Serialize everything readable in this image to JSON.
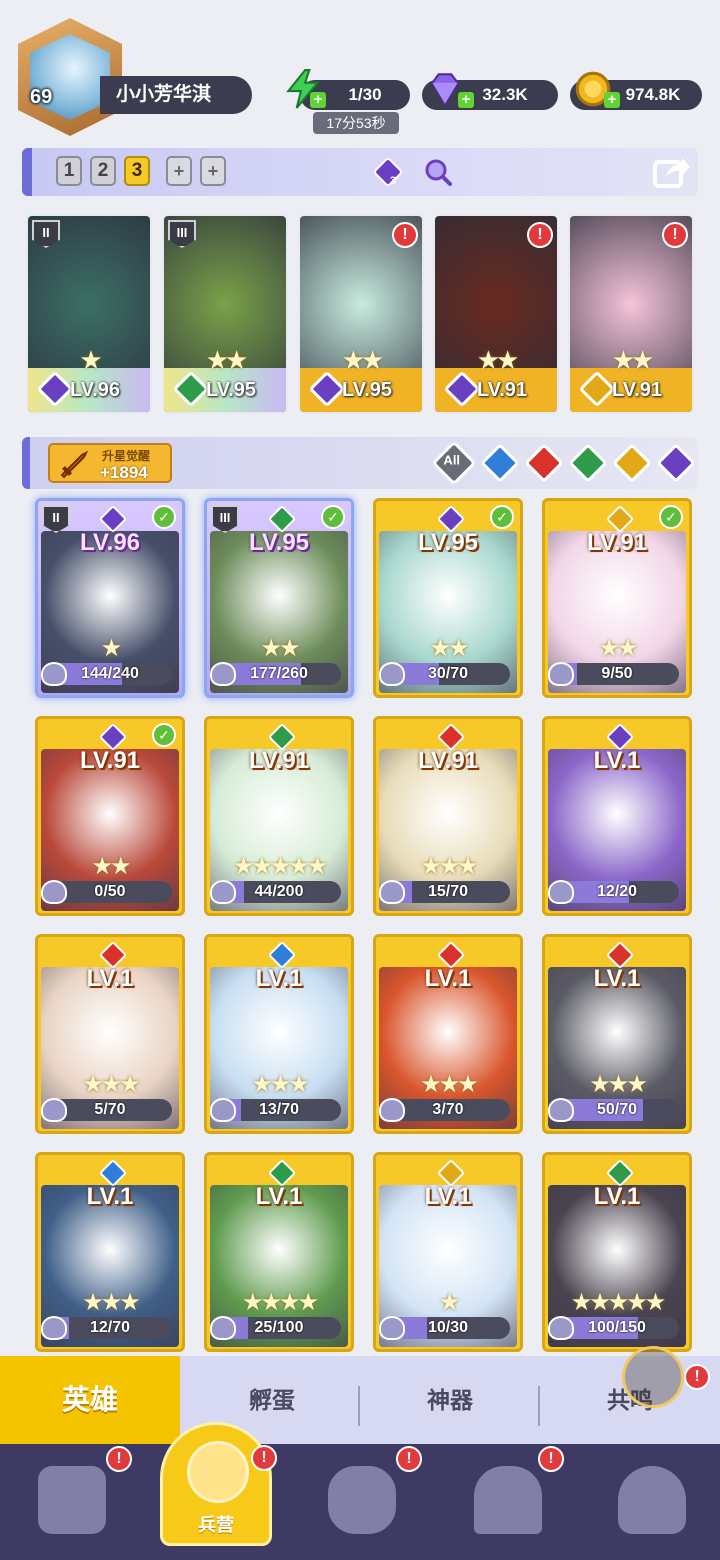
{
  "player": {
    "level": "69",
    "name": "小小芳华淇"
  },
  "resources": {
    "energy": {
      "value": "1/30",
      "timer": "17分53秒",
      "icon": "energy-bolt-icon",
      "color": "#3fcf55"
    },
    "gems": {
      "value": "32.3K",
      "icon": "purple-gem-icon",
      "color": "#8a63e8"
    },
    "gold": {
      "value": "974.8K",
      "icon": "gold-coin-icon",
      "color": "#f0b820"
    }
  },
  "team_bar": {
    "slots": [
      "1",
      "2",
      "3",
      "+",
      "+"
    ],
    "active_slot": "3",
    "dark_counter": "3"
  },
  "team": [
    {
      "level": "LV.96",
      "element": "dark",
      "rank": "II",
      "stars": "★",
      "alert": false
    },
    {
      "level": "LV.95",
      "element": "nature",
      "rank": "III",
      "stars": "★★",
      "alert": false
    },
    {
      "level": "LV.95",
      "element": "dark",
      "rank": "",
      "stars": "★★",
      "alert": true
    },
    {
      "level": "LV.91",
      "element": "dark",
      "rank": "",
      "stars": "★★",
      "alert": true
    },
    {
      "level": "LV.91",
      "element": "light",
      "rank": "",
      "stars": "★★",
      "alert": true
    }
  ],
  "filter_bar": {
    "star_up_label": "升星觉醒",
    "star_up_value": "+1894",
    "filter_all": "All",
    "elements": [
      "water",
      "fire",
      "nature",
      "light",
      "dark"
    ]
  },
  "element_colors": {
    "dark": "#6a3fc2",
    "nature": "#2e9b4a",
    "fire": "#d8322a",
    "water": "#2f7fd8",
    "light": "#e2a818"
  },
  "heroes": [
    {
      "level": "LV.96",
      "element": "dark",
      "progress": "144/240",
      "fraction": 0.6,
      "stars": "★",
      "checked": true,
      "rank": "II",
      "selected": true,
      "art": "#46506a"
    },
    {
      "level": "LV.95",
      "element": "nature",
      "progress": "177/260",
      "fraction": 0.68,
      "stars": "★★",
      "checked": true,
      "rank": "III",
      "selected": true,
      "art": "#6d8d5a"
    },
    {
      "level": "LV.95",
      "element": "dark",
      "progress": "30/70",
      "fraction": 0.43,
      "stars": "★★",
      "checked": true,
      "rank": "",
      "selected": false,
      "art": "#a9d8cf"
    },
    {
      "level": "LV.91",
      "element": "light",
      "progress": "9/50",
      "fraction": 0.18,
      "stars": "★★",
      "checked": true,
      "rank": "",
      "selected": false,
      "art": "#f2d6e8"
    },
    {
      "level": "LV.91",
      "element": "dark",
      "progress": "0/50",
      "fraction": 0.0,
      "stars": "★★",
      "checked": true,
      "rank": "",
      "selected": false,
      "art": "#b9483a"
    },
    {
      "level": "LV.91",
      "element": "nature",
      "progress": "44/200",
      "fraction": 0.22,
      "stars": "★★★★★",
      "checked": false,
      "rank": "",
      "selected": false,
      "art": "#d6ecd6"
    },
    {
      "level": "LV.91",
      "element": "fire",
      "progress": "15/70",
      "fraction": 0.21,
      "stars": "★★★",
      "checked": false,
      "rank": "",
      "selected": false,
      "art": "#e8dcb8"
    },
    {
      "level": "LV.1",
      "element": "dark",
      "progress": "12/20",
      "fraction": 0.6,
      "stars": "",
      "checked": false,
      "rank": "",
      "selected": false,
      "art": "#8b67c9"
    },
    {
      "level": "LV.1",
      "element": "fire",
      "progress": "5/70",
      "fraction": 0.07,
      "stars": "★★★",
      "checked": false,
      "rank": "",
      "selected": false,
      "art": "#e9d4c4"
    },
    {
      "level": "LV.1",
      "element": "water",
      "progress": "13/70",
      "fraction": 0.19,
      "stars": "★★★",
      "checked": false,
      "rank": "",
      "selected": false,
      "art": "#c7def2"
    },
    {
      "level": "LV.1",
      "element": "fire",
      "progress": "3/70",
      "fraction": 0.04,
      "stars": "★★★",
      "checked": false,
      "rank": "",
      "selected": false,
      "art": "#d9552d"
    },
    {
      "level": "LV.1",
      "element": "fire",
      "progress": "50/70",
      "fraction": 0.71,
      "stars": "★★★",
      "checked": false,
      "rank": "",
      "selected": false,
      "art": "#5b5b66"
    },
    {
      "level": "LV.1",
      "element": "water",
      "progress": "12/70",
      "fraction": 0.17,
      "stars": "★★★",
      "checked": false,
      "rank": "",
      "selected": false,
      "art": "#3f5f88"
    },
    {
      "level": "LV.1",
      "element": "nature",
      "progress": "25/100",
      "fraction": 0.25,
      "stars": "★★★★",
      "checked": false,
      "rank": "",
      "selected": false,
      "art": "#5f9b4f"
    },
    {
      "level": "LV.1",
      "element": "light",
      "progress": "10/30",
      "fraction": 0.33,
      "stars": "★",
      "checked": false,
      "rank": "",
      "selected": false,
      "art": "#d3e4f6"
    },
    {
      "level": "LV.1",
      "element": "nature",
      "progress": "100/150",
      "fraction": 0.67,
      "stars": "★★★★★",
      "checked": false,
      "rank": "",
      "selected": false,
      "art": "#4a4450"
    }
  ],
  "tabs": {
    "active": "英雄",
    "hatch": "孵蛋",
    "artifact": "神器",
    "resonance": "共鸣"
  },
  "bottom_nav": {
    "active_label": "兵营",
    "items": [
      "cards-icon",
      "barracks-icon",
      "map-icon",
      "temple-icon",
      "mushroom-icon"
    ]
  }
}
